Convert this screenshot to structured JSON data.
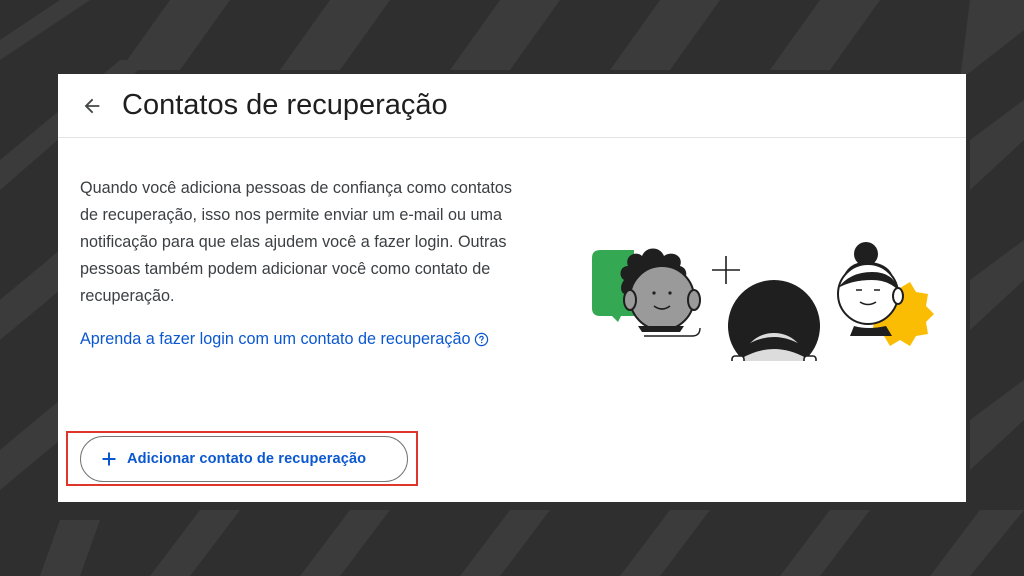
{
  "page": {
    "title": "Contatos de recuperação",
    "description": "Quando você adiciona pessoas de confiança como contatos de recuperação, isso nos permite enviar um e-mail ou uma notificação para que elas ajudem você a fazer login. Outras pessoas também podem adicionar você como contato de recuperação.",
    "help_link": "Aprenda a fazer login com um contato de recuperação",
    "add_button_label": "Adicionar contato de recuperação"
  },
  "icons": {
    "back": "arrow-back-icon",
    "help": "help-circle-icon",
    "add": "plus-icon"
  },
  "colors": {
    "link": "#0b57d0",
    "highlight": "#e0352b",
    "illustration_green": "#34a853",
    "illustration_blue": "#1a5fd6",
    "illustration_yellow": "#fbbc04"
  }
}
